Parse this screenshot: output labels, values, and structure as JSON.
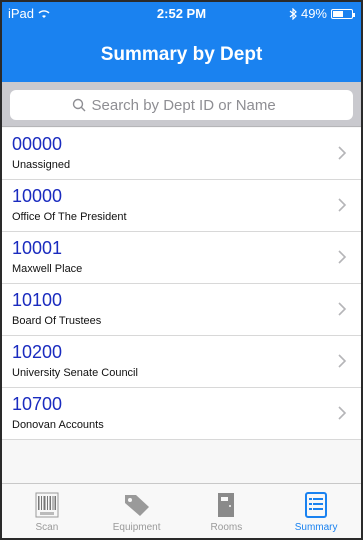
{
  "status": {
    "device": "iPad",
    "time": "2:52 PM",
    "battery": "49%"
  },
  "header": {
    "title": "Summary by Dept"
  },
  "search": {
    "placeholder": "Search by Dept ID or Name"
  },
  "departments": [
    {
      "code": "00000",
      "name": "Unassigned"
    },
    {
      "code": "10000",
      "name": "Office Of The President"
    },
    {
      "code": "10001",
      "name": "Maxwell Place"
    },
    {
      "code": "10100",
      "name": "Board Of Trustees"
    },
    {
      "code": "10200",
      "name": "University Senate Council"
    },
    {
      "code": "10700",
      "name": "Donovan Accounts"
    }
  ],
  "tabs": [
    {
      "label": "Scan",
      "icon": "barcode-icon",
      "active": false
    },
    {
      "label": "Equipment",
      "icon": "tag-icon",
      "active": false
    },
    {
      "label": "Rooms",
      "icon": "door-icon",
      "active": false
    },
    {
      "label": "Summary",
      "icon": "list-icon",
      "active": true
    }
  ],
  "colors": {
    "accent": "#1a82f0",
    "code_text": "#1a2bbf"
  }
}
